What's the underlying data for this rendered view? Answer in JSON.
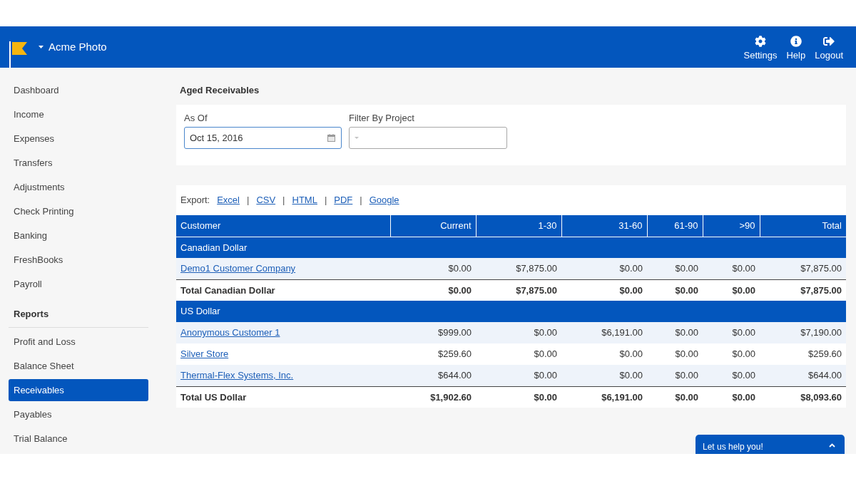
{
  "header": {
    "app_name": "Acme Photo",
    "actions": [
      {
        "kind": "settings",
        "label": "Settings"
      },
      {
        "kind": "help",
        "label": "Help"
      },
      {
        "kind": "logout",
        "label": "Logout"
      }
    ]
  },
  "sidebar": {
    "sections": [
      {
        "items": [
          {
            "label": "Dashboard",
            "selected": false
          },
          {
            "label": "Income",
            "selected": false
          },
          {
            "label": "Expenses",
            "selected": false
          },
          {
            "label": "Transfers",
            "selected": false
          },
          {
            "label": "Adjustments",
            "selected": false
          },
          {
            "label": "Check Printing",
            "selected": false
          },
          {
            "label": "Banking",
            "selected": false
          },
          {
            "label": "FreshBooks",
            "selected": false
          },
          {
            "label": "Payroll",
            "selected": false
          }
        ]
      },
      {
        "title": "Reports",
        "items": [
          {
            "label": "Profit and Loss",
            "selected": false
          },
          {
            "label": "Balance Sheet",
            "selected": false
          },
          {
            "label": "Receivables",
            "selected": true
          },
          {
            "label": "Payables",
            "selected": false
          },
          {
            "label": "Trial Balance",
            "selected": false
          }
        ]
      }
    ]
  },
  "page": {
    "title": "Aged Receivables"
  },
  "filters": {
    "as_of": {
      "label": "As Of",
      "value": "Oct 15, 2016"
    },
    "project": {
      "label": "Filter By Project"
    }
  },
  "export": {
    "label": "Export:",
    "separator": "|",
    "links": [
      "Excel",
      "CSV",
      "HTML",
      "PDF",
      "Google"
    ]
  },
  "table": {
    "columns": [
      "Customer",
      "Current",
      "1-30",
      "31-60",
      "61-90",
      ">90",
      "Total"
    ],
    "groups": [
      {
        "name": "Canadian Dollar",
        "rows": [
          {
            "customer": "Demo1 Customer Company",
            "amounts": [
              "$0.00",
              "$7,875.00",
              "$0.00",
              "$0.00",
              "$0.00",
              "$7,875.00"
            ]
          }
        ],
        "total": {
          "label": "Total Canadian Dollar",
          "amounts": [
            "$0.00",
            "$7,875.00",
            "$0.00",
            "$0.00",
            "$0.00",
            "$7,875.00"
          ]
        }
      },
      {
        "name": "US Dollar",
        "rows": [
          {
            "customer": "Anonymous Customer 1",
            "amounts": [
              "$999.00",
              "$0.00",
              "$6,191.00",
              "$0.00",
              "$0.00",
              "$7,190.00"
            ]
          },
          {
            "customer": "Silver Store",
            "amounts": [
              "$259.60",
              "$0.00",
              "$0.00",
              "$0.00",
              "$0.00",
              "$259.60"
            ]
          },
          {
            "customer": "Thermal-Flex Systems, Inc.",
            "amounts": [
              "$644.00",
              "$0.00",
              "$0.00",
              "$0.00",
              "$0.00",
              "$644.00"
            ]
          }
        ],
        "total": {
          "label": "Total US Dollar",
          "amounts": [
            "$1,902.60",
            "$0.00",
            "$6,191.00",
            "$0.00",
            "$0.00",
            "$8,093.60"
          ]
        }
      }
    ]
  },
  "chat": {
    "label": "Let us help you!"
  }
}
